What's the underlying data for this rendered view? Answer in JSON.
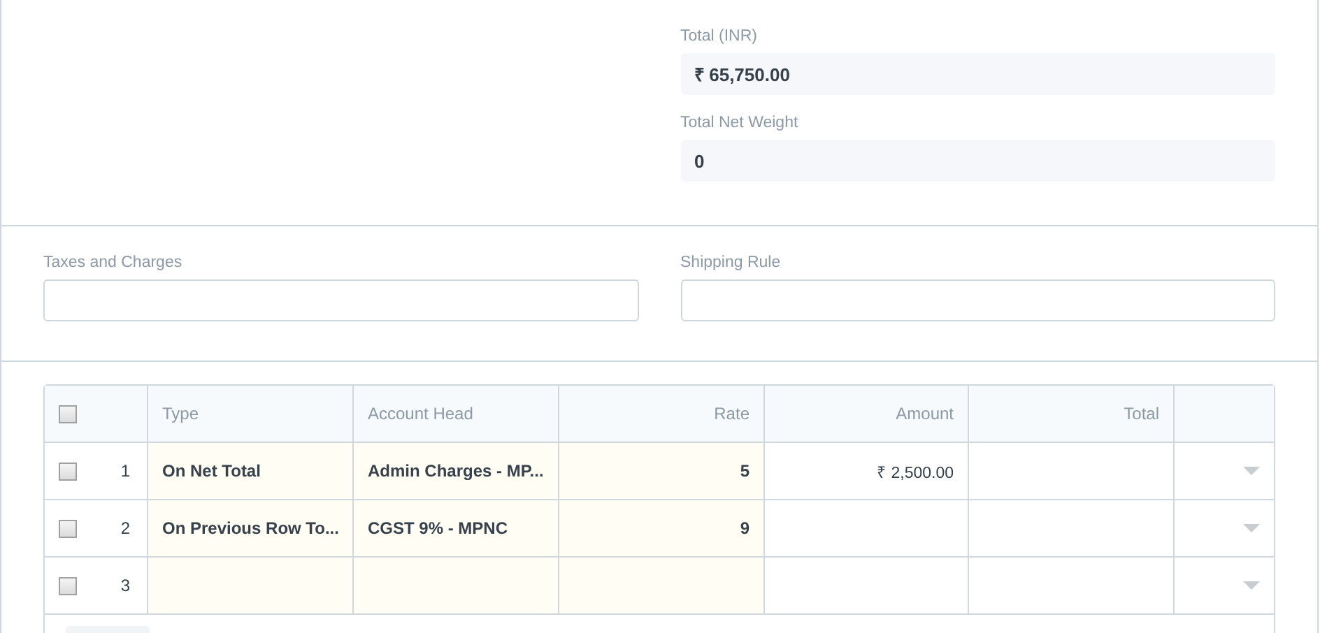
{
  "totals": [
    {
      "label": "Total (INR)",
      "value": "₹ 65,750.00"
    },
    {
      "label": "Total Net Weight",
      "value": "0"
    }
  ],
  "fields": [
    {
      "label": "Taxes and Charges"
    },
    {
      "label": "Shipping Rule"
    }
  ],
  "table": {
    "select_all": {
      "checked": false
    },
    "columns": [
      "Type",
      "Account Head",
      "Rate",
      "Amount",
      "Total"
    ],
    "rows": [
      {
        "checked": false,
        "index": "1",
        "type": "On Net Total",
        "account_head": "Admin Charges - MP...",
        "rate": "5",
        "amount": "₹ 2,500.00",
        "total": ""
      },
      {
        "checked": false,
        "index": "2",
        "type": "On Previous Row To...",
        "account_head": "CGST 9% - MPNC",
        "rate": "9",
        "amount": "",
        "total": ""
      },
      {
        "checked": false,
        "index": "3",
        "type": "",
        "account_head": "",
        "rate": "",
        "amount": "",
        "total": ""
      }
    ]
  }
}
